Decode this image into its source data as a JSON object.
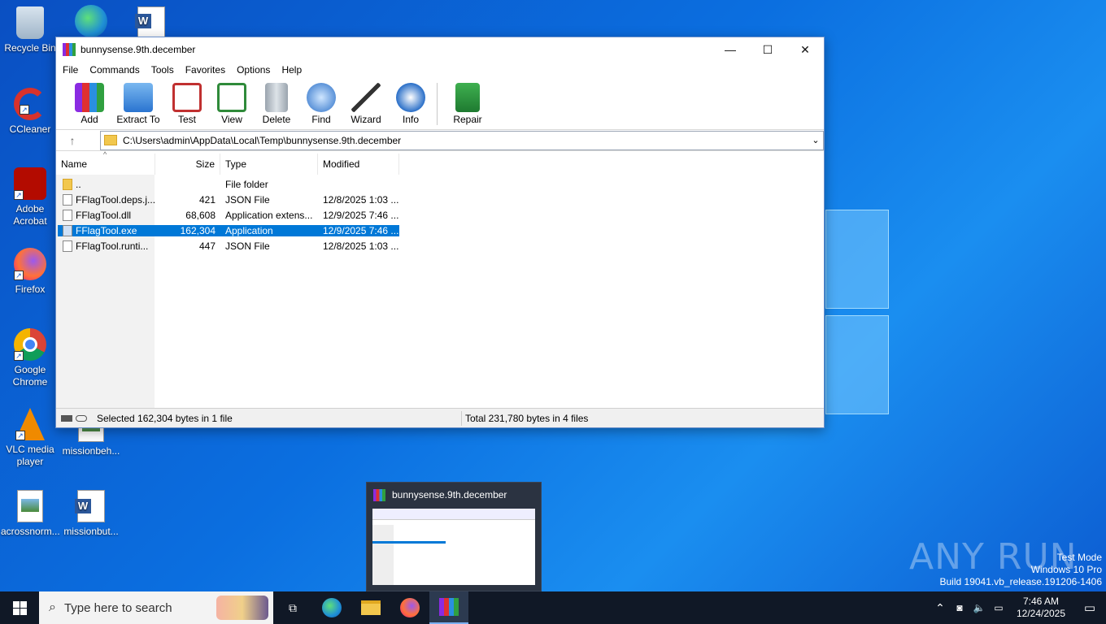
{
  "desktop": {
    "icons": [
      {
        "label": "Recycle Bin"
      },
      {
        "label": "CCleaner"
      },
      {
        "label": "Adobe Acrobat"
      },
      {
        "label": "Firefox"
      },
      {
        "label": "Google Chrome"
      },
      {
        "label": "VLC media player"
      },
      {
        "label": "missionbeh..."
      },
      {
        "label": "acrossnorm..."
      },
      {
        "label": "missionbut..."
      }
    ]
  },
  "window": {
    "title": "bunnysense.9th.december",
    "menu": [
      "File",
      "Commands",
      "Tools",
      "Favorites",
      "Options",
      "Help"
    ],
    "toolbar": [
      "Add",
      "Extract To",
      "Test",
      "View",
      "Delete",
      "Find",
      "Wizard",
      "Info",
      "Repair"
    ],
    "address": "C:\\Users\\admin\\AppData\\Local\\Temp\\bunnysense.9th.december",
    "columns": {
      "name": "Name",
      "size": "Size",
      "type": "Type",
      "modified": "Modified"
    },
    "files": [
      {
        "name": "..",
        "size": "",
        "type": "File folder",
        "modified": ""
      },
      {
        "name": "FFlagTool.deps.j...",
        "size": "421",
        "type": "JSON File",
        "modified": "12/8/2025 1:03 ..."
      },
      {
        "name": "FFlagTool.dll",
        "size": "68,608",
        "type": "Application extens...",
        "modified": "12/9/2025 7:46 ..."
      },
      {
        "name": "FFlagTool.exe",
        "size": "162,304",
        "type": "Application",
        "modified": "12/9/2025 7:46 ..."
      },
      {
        "name": "FFlagTool.runti...",
        "size": "447",
        "type": "JSON File",
        "modified": "12/8/2025 1:03 ..."
      }
    ],
    "status_left": "Selected 162,304 bytes in 1 file",
    "status_right": "Total 231,780 bytes in 4 files"
  },
  "thumbnail": {
    "title": "bunnysense.9th.december"
  },
  "taskbar": {
    "search_placeholder": "Type here to search",
    "time": "7:46 AM",
    "date": "12/24/2025"
  },
  "watermark": {
    "brand": "ANY RUN",
    "line1": "Test Mode",
    "line2": "Windows 10 Pro",
    "line3": "Build 19041.vb_release.191206-1406"
  }
}
